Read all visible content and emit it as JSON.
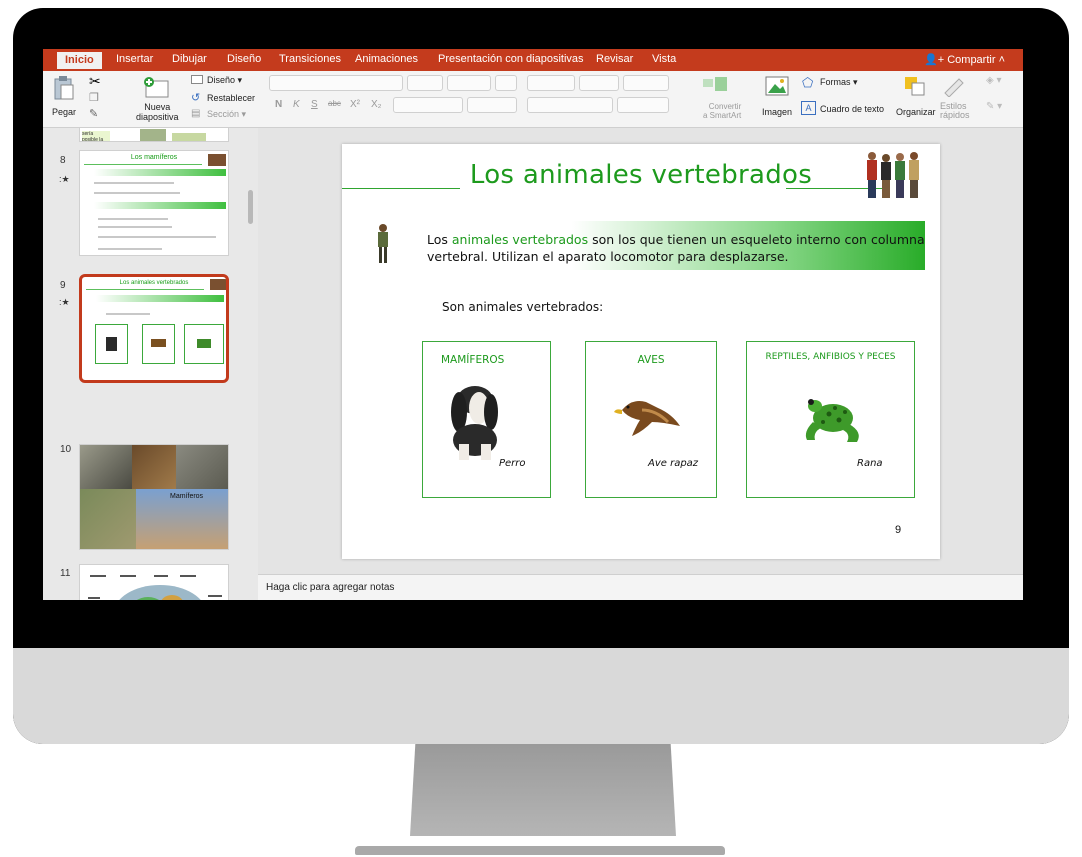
{
  "ribbon": {
    "tabs": [
      "Inicio",
      "Insertar",
      "Dibujar",
      "Diseño",
      "Transiciones",
      "Animaciones",
      "Presentación con diapositivas",
      "Revisar",
      "Vista"
    ],
    "share_label": "Compartir",
    "paste_label": "Pegar",
    "new_slide_label": "Nueva\ndiapositiva",
    "design_label": "Diseño",
    "reset_label": "Restablecer",
    "section_label": "Sección",
    "format_buttons": [
      "N",
      "K",
      "S",
      "abc",
      "X²",
      "X₂"
    ],
    "convert_smartart_label": "Convertir\na SmartArt",
    "image_label": "Imagen",
    "shapes_label": "Formas",
    "textbox_label": "Cuadro de texto",
    "arrange_label": "Organizar",
    "quick_styles_label": "Estilos\nrápidos"
  },
  "thumbnails": {
    "partial_top_text": "sería posible la vida",
    "slides": [
      {
        "number": "8",
        "title": "Los mamíferos"
      },
      {
        "number": "9",
        "title": "Los animales vertebrados"
      },
      {
        "number": "10",
        "title": "Mamíferos"
      },
      {
        "number": "11",
        "title": ""
      }
    ]
  },
  "slide": {
    "title": "Los animales vertebrados",
    "intro_before": "Los ",
    "intro_highlight": "animales vertebrados",
    "intro_after": " son los que tienen un esqueleto interno con columna vertebral. Utilizan el aparato locomotor para desplazarse.",
    "subheading": "Son animales vertebrados:",
    "cards": [
      {
        "title": "MAMÍFEROS",
        "caption": "Perro"
      },
      {
        "title": "AVES",
        "caption": "Ave rapaz"
      },
      {
        "title": "REPTILES, ANFIBIOS Y PECES",
        "caption": "Rana"
      }
    ],
    "page_number": "9"
  },
  "notes": {
    "placeholder": "Haga clic para agregar notas"
  }
}
